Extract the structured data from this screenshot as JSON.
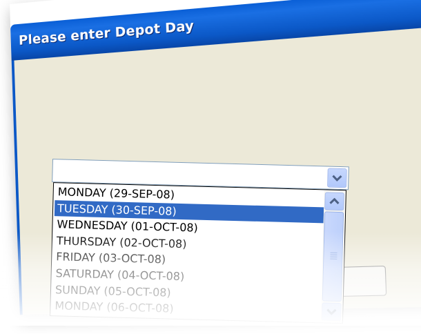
{
  "dialog": {
    "title": "Please enter Depot Day"
  },
  "combo": {
    "value": ""
  },
  "dropdown": {
    "selected_index": 1,
    "options": [
      "MONDAY (29-SEP-08)",
      "TUESDAY (30-SEP-08)",
      "WEDNESDAY (01-OCT-08)",
      "THURSDAY (02-OCT-08)",
      "FRIDAY (03-OCT-08)",
      "SATURDAY (04-OCT-08)",
      "SUNDAY (05-OCT-08)",
      "MONDAY (06-OCT-08)"
    ]
  },
  "icons": {
    "combo_arrow": "chevron-down-icon",
    "scroll_up": "chevron-up-icon",
    "scroll_down": "chevron-down-icon"
  },
  "colors": {
    "titlebar": "#0b58c7",
    "client": "#ece9d8",
    "selection": "#316ac5"
  }
}
